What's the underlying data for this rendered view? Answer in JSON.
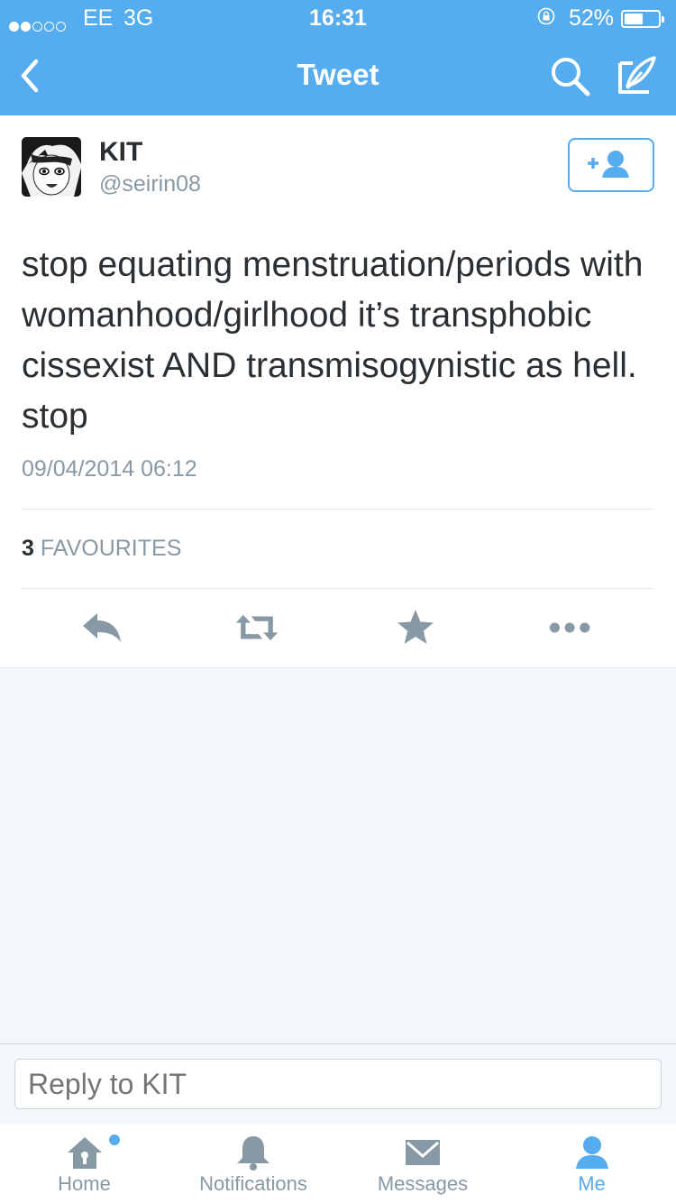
{
  "status_bar": {
    "carrier": "EE",
    "network": "3G",
    "time": "16:31",
    "battery": "52%"
  },
  "nav": {
    "title": "Tweet",
    "back_icon": "chevron-left-icon",
    "search_icon": "search-icon",
    "compose_icon": "compose-icon"
  },
  "tweet": {
    "name": "KIT",
    "handle": "@seirin08",
    "text": "stop equating menstruation/periods with womanhood/girlhood it’s transphobic cissexist AND transmisogynistic as hell. stop",
    "timestamp": "09/04/2014 06:12",
    "favourites_count": "3",
    "favourites_label": "FAVOURITES"
  },
  "reply": {
    "placeholder": "Reply to KIT"
  },
  "tabs": [
    {
      "label": "Home",
      "icon": "home-icon"
    },
    {
      "label": "Notifications",
      "icon": "bell-icon"
    },
    {
      "label": "Messages",
      "icon": "envelope-icon"
    },
    {
      "label": "Me",
      "icon": "person-icon",
      "active": true
    }
  ],
  "colors": {
    "brand": "#55acee",
    "text": "#292f33",
    "muted": "#8899a6",
    "background": "#f5f8fa"
  }
}
